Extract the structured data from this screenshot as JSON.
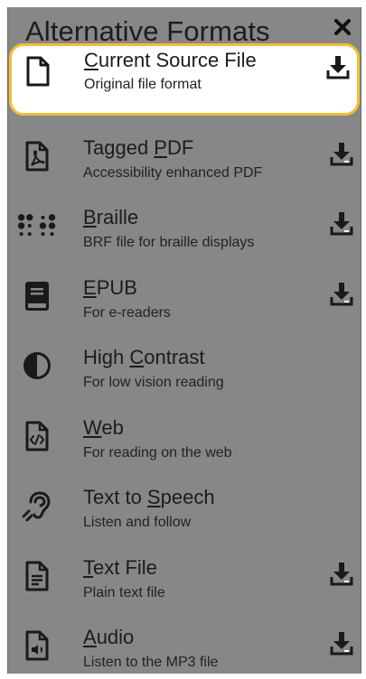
{
  "dialog": {
    "title": "Alternative Formats",
    "close_icon": "close-icon"
  },
  "formats": [
    {
      "pre": "",
      "key": "C",
      "post": "urrent Source File",
      "description": "Original file format",
      "icon": "file-icon",
      "download": true,
      "highlighted": true
    },
    {
      "pre": "Tagged ",
      "key": "P",
      "post": "DF",
      "description": "Accessibility enhanced PDF",
      "icon": "pdf-icon",
      "download": true,
      "highlighted": false
    },
    {
      "pre": "",
      "key": "B",
      "post": "raille",
      "description": "BRF file for braille displays",
      "icon": "braille-icon",
      "download": true,
      "highlighted": false
    },
    {
      "pre": "",
      "key": "E",
      "post": "PUB",
      "description": "For e-readers",
      "icon": "book-icon",
      "download": true,
      "highlighted": false
    },
    {
      "pre": "High ",
      "key": "C",
      "post": "ontrast",
      "description": "For low vision reading",
      "icon": "contrast-icon",
      "download": false,
      "highlighted": false
    },
    {
      "pre": "",
      "key": "W",
      "post": "eb",
      "description": "For reading on the web",
      "icon": "code-file-icon",
      "download": false,
      "highlighted": false
    },
    {
      "pre": "Text to ",
      "key": "S",
      "post": "peech",
      "description": "Listen and follow",
      "icon": "hearing-icon",
      "download": false,
      "highlighted": false
    },
    {
      "pre": "",
      "key": "T",
      "post": "ext File",
      "description": "Plain text file",
      "icon": "text-file-icon",
      "download": true,
      "highlighted": false
    },
    {
      "pre": "",
      "key": "A",
      "post": "udio",
      "description": "Listen to the MP3 file",
      "icon": "audio-file-icon",
      "download": true,
      "highlighted": false
    }
  ],
  "colors": {
    "overlay": "#878787",
    "highlight_border": "#f1bf35",
    "text": "#1c1c1c"
  }
}
